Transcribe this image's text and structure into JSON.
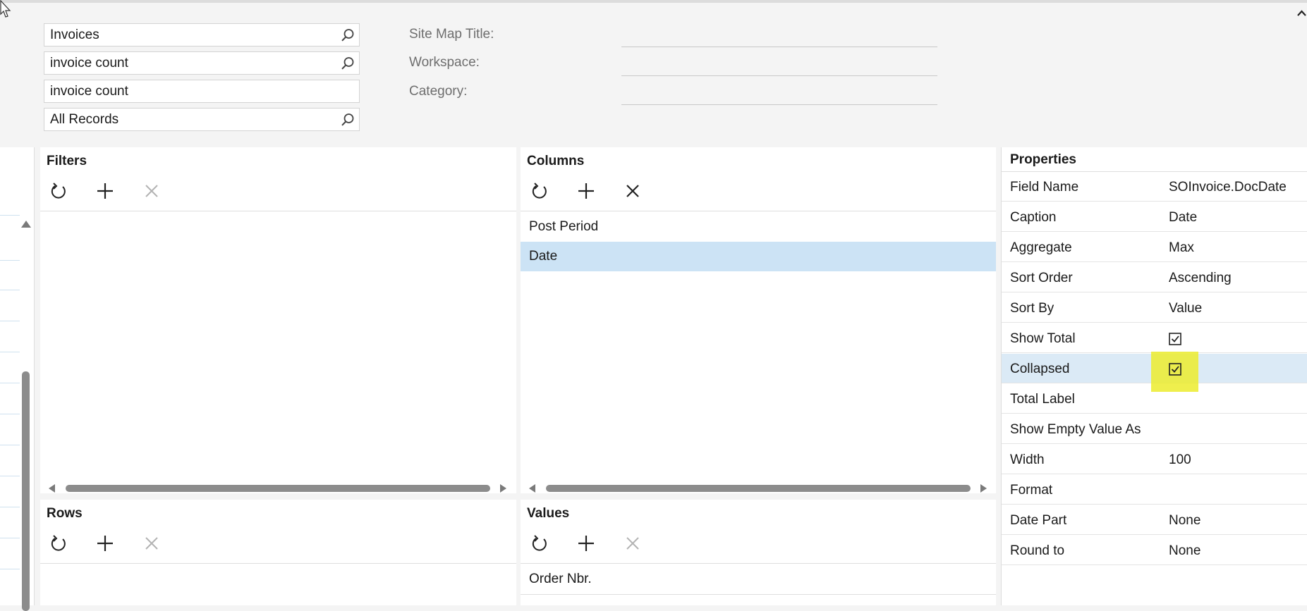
{
  "header": {
    "lookups": [
      {
        "value": "Invoices",
        "has_search": true
      },
      {
        "value": "invoice count",
        "has_search": true
      },
      {
        "value": "invoice count",
        "has_search": false
      },
      {
        "value": "All Records",
        "has_search": true
      }
    ],
    "fields": [
      {
        "label": "Site Map Title:",
        "value": ""
      },
      {
        "label": "Workspace:",
        "value": ""
      },
      {
        "label": "Category:",
        "value": ""
      }
    ]
  },
  "filters": {
    "title": "Filters",
    "items": []
  },
  "columns": {
    "title": "Columns",
    "items": [
      "Post Period",
      "Date"
    ],
    "selected_index": 1
  },
  "rows": {
    "title": "Rows",
    "items": []
  },
  "values": {
    "title": "Values",
    "items": [
      "Order Nbr."
    ]
  },
  "properties": {
    "title": "Properties",
    "rows": [
      {
        "name": "Field Name",
        "value": "SOInvoice.DocDate"
      },
      {
        "name": "Caption",
        "value": "Date"
      },
      {
        "name": "Aggregate",
        "value": "Max"
      },
      {
        "name": "Sort Order",
        "value": "Ascending"
      },
      {
        "name": "Sort By",
        "value": "Value"
      },
      {
        "name": "Show Total",
        "value": "",
        "checked": true
      },
      {
        "name": "Collapsed",
        "value": "",
        "checked": true,
        "highlighted": true
      },
      {
        "name": "Total Label",
        "value": ""
      },
      {
        "name": "Show Empty Value As",
        "value": ""
      },
      {
        "name": "Width",
        "value": "100"
      },
      {
        "name": "Format",
        "value": ""
      },
      {
        "name": "Date Part",
        "value": "None"
      },
      {
        "name": "Round to",
        "value": "None"
      }
    ]
  },
  "colors": {
    "selection": "#cce3f5",
    "highlight": "#ecec2e",
    "border": "#dedede"
  }
}
